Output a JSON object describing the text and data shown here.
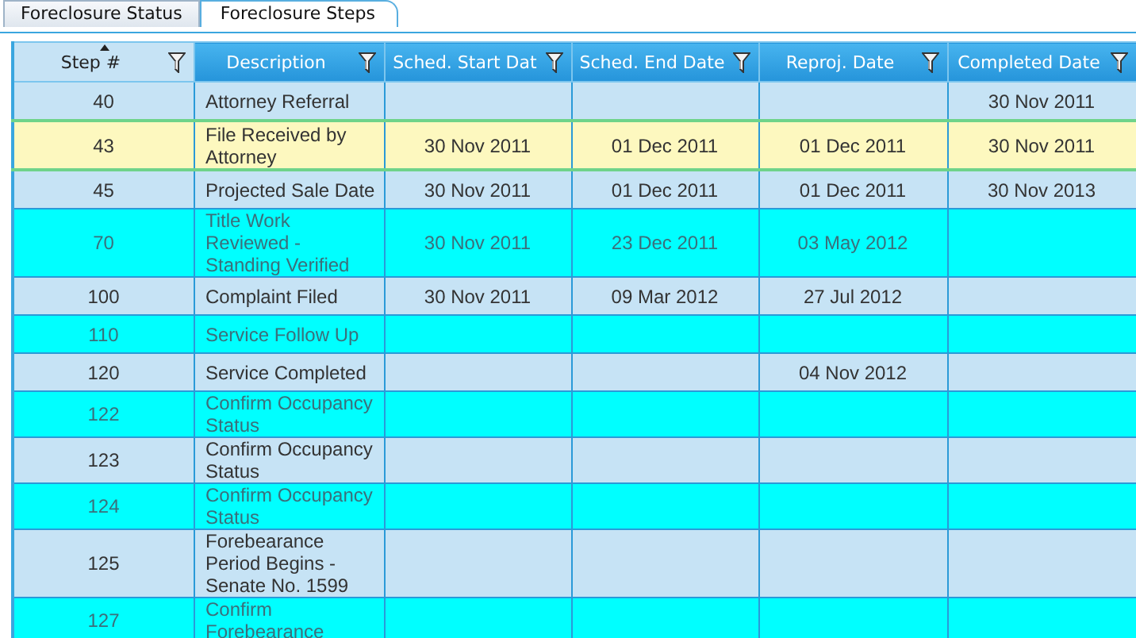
{
  "tabs": [
    {
      "label": "Foreclosure Status",
      "selected": false
    },
    {
      "label": "Foreclosure Steps",
      "selected": true
    }
  ],
  "table": {
    "columns": [
      {
        "label": "Step #",
        "sorted": true
      },
      {
        "label": "Description",
        "sorted": false
      },
      {
        "label": "Sched. Start Dat",
        "sorted": false
      },
      {
        "label": "Sched. End Date",
        "sorted": false
      },
      {
        "label": "Reproj. Date",
        "sorted": false
      },
      {
        "label": "Completed Date",
        "sorted": false
      }
    ],
    "rows": [
      {
        "selected": false,
        "cells": [
          "40",
          "Attorney Referral",
          "",
          "",
          "",
          "30 Nov 2011"
        ]
      },
      {
        "selected": true,
        "cells": [
          "43",
          "File Received by Attorney",
          "30 Nov 2011",
          "01 Dec 2011",
          "01 Dec 2011",
          "30 Nov 2011"
        ]
      },
      {
        "selected": false,
        "cells": [
          "45",
          "Projected Sale Date",
          "30 Nov 2011",
          "01 Dec 2011",
          "01 Dec 2011",
          "30 Nov 2013"
        ]
      },
      {
        "selected": false,
        "cells": [
          "70",
          "Title Work Reviewed - Standing Verified",
          "30 Nov 2011",
          "23 Dec 2011",
          "03 May 2012",
          ""
        ]
      },
      {
        "selected": false,
        "cells": [
          "100",
          "Complaint Filed",
          "30 Nov 2011",
          "09 Mar 2012",
          "27 Jul 2012",
          ""
        ]
      },
      {
        "selected": false,
        "cells": [
          "110",
          "Service Follow Up",
          "",
          "",
          "",
          ""
        ]
      },
      {
        "selected": false,
        "cells": [
          "120",
          "Service Completed",
          "",
          "",
          "04 Nov 2012",
          ""
        ]
      },
      {
        "selected": false,
        "cells": [
          "122",
          "Confirm Occupancy Status",
          "",
          "",
          "",
          ""
        ]
      },
      {
        "selected": false,
        "cells": [
          "123",
          "Confirm Occupancy Status",
          "",
          "",
          "",
          ""
        ]
      },
      {
        "selected": false,
        "cells": [
          "124",
          "Confirm Occupancy Status",
          "",
          "",
          "",
          ""
        ]
      },
      {
        "selected": false,
        "cells": [
          "125",
          "Forebearance Period Begins - Senate No. 1599",
          "",
          "",
          "",
          ""
        ]
      },
      {
        "selected": false,
        "cells": [
          "127",
          "Confirm Forebearance",
          "",
          "",
          "",
          ""
        ]
      }
    ]
  }
}
